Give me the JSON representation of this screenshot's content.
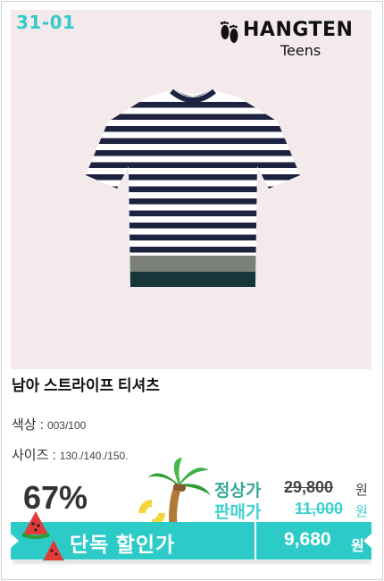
{
  "product": {
    "code": "31-01",
    "brand_name": "HANGTEN",
    "brand_sub": "Teens",
    "title": "남아 스트라이프 티셔츠"
  },
  "specs": {
    "color_label": "색상 :",
    "color_value": "003/100",
    "size_label": "사이즈 :",
    "size_value": "130./140./150."
  },
  "pricing": {
    "discount": "67%",
    "regular_label": "정상가",
    "regular_price": "29,800",
    "sale_label": "판매가",
    "sale_price": "11,000",
    "currency": "원",
    "banner_label": "단독 할인가",
    "final_price": "9,680",
    "final_currency": "원"
  },
  "icons": [
    "footprints-icon",
    "palm-tree-icon",
    "swim-ring-icon",
    "watermelon-icon"
  ],
  "colors": {
    "accent": "#2dcbc8",
    "sale_label": "#3fd0d0",
    "photo_bg": "#f4eaec",
    "navy": "#1d2240"
  }
}
